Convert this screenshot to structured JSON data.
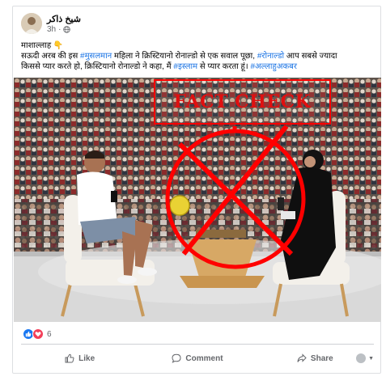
{
  "post": {
    "author": "شیخ ذاکر",
    "time": "3h",
    "visibility_icon": "globe-icon",
    "text_lines": [
      [
        {
          "t": "माशाल्लाह 👇",
          "tag": false
        }
      ],
      [
        {
          "t": "सऊदी अरब की इस ",
          "tag": false
        },
        {
          "t": "#मुसलमान",
          "tag": true
        },
        {
          "t": " महिला ने क्रिस्टियानो रोनाल्डो से एक सवाल पूछा, ",
          "tag": false
        },
        {
          "t": "#रोनाल्डो",
          "tag": true
        },
        {
          "t": " आप सबसे ज्यादा",
          "tag": false
        }
      ],
      [
        {
          "t": "किससे प्यार करते हो, क्रिस्टियानो रोनाल्डो ने कहा, मैं ",
          "tag": false
        },
        {
          "t": "#इस्लाम",
          "tag": true
        },
        {
          "t": " से प्यार करता हूं। ",
          "tag": false
        },
        {
          "t": "#अल्लाहुअकबर",
          "tag": true
        }
      ]
    ],
    "image_overlay": "FACT CHECK"
  },
  "reactions": {
    "count": "6",
    "icons": [
      "like-icon",
      "love-icon"
    ]
  },
  "actions": {
    "like": "Like",
    "comment": "Comment",
    "share": "Share"
  },
  "colors": {
    "link": "#1b74e4",
    "overlay_red": "#ff0000",
    "like_blue": "#1877f2",
    "love_red": "#f33e58"
  }
}
